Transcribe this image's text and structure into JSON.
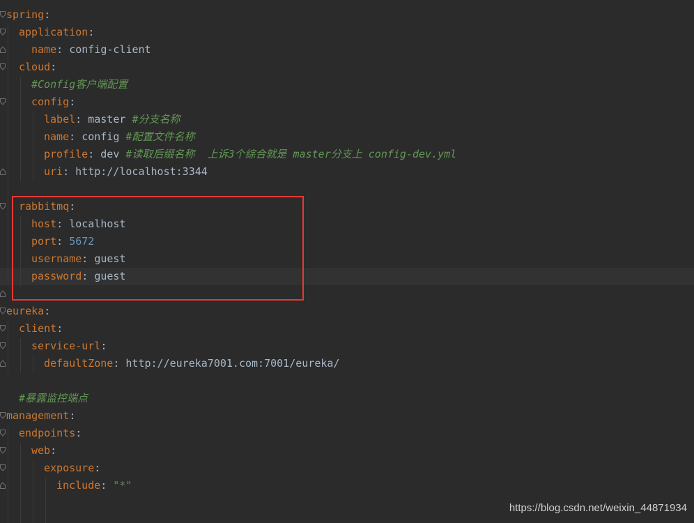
{
  "editor": {
    "file_type": "yaml",
    "theme_colors": {
      "background": "#2b2b2b",
      "key": "#cc7832",
      "value": "#a9b7c6",
      "number": "#6897bb",
      "string": "#6a8759",
      "comment": "#629755",
      "highlight_box": "#e53935"
    },
    "lines": {
      "l1": {
        "key": "spring",
        "colon": ":"
      },
      "l2": {
        "key": "application",
        "colon": ":"
      },
      "l3": {
        "key": "name",
        "colon": ": ",
        "value": "config-client"
      },
      "l4": {
        "key": "cloud",
        "colon": ":"
      },
      "l5": {
        "comment": "#Config客户端配置"
      },
      "l6": {
        "key": "config",
        "colon": ":"
      },
      "l7": {
        "key": "label",
        "colon": ": ",
        "value": "master ",
        "comment": "#分支名称"
      },
      "l8": {
        "key": "name",
        "colon": ": ",
        "value": "config ",
        "comment": "#配置文件名称"
      },
      "l9": {
        "key": "profile",
        "colon": ": ",
        "value": "dev ",
        "comment": "#读取后缀名称  上诉3个综合就是 master分支上 config-dev.yml"
      },
      "l10": {
        "key": "uri",
        "colon": ": ",
        "value": "http://localhost:3344"
      },
      "l12": {
        "key": "rabbitmq",
        "colon": ":"
      },
      "l13": {
        "key": "host",
        "colon": ": ",
        "value": "localhost"
      },
      "l14": {
        "key": "port",
        "colon": ": ",
        "value": "5672"
      },
      "l15": {
        "key": "username",
        "colon": ": ",
        "value": "guest"
      },
      "l16": {
        "key": "password",
        "colon": ": ",
        "value": "guest"
      },
      "l18": {
        "key": "eureka",
        "colon": ":"
      },
      "l19": {
        "key": "client",
        "colon": ":"
      },
      "l20": {
        "key": "service-url",
        "colon": ":"
      },
      "l21": {
        "key": "defaultZone",
        "colon": ": ",
        "value": "http://eureka7001.com:7001/eureka/"
      },
      "l23": {
        "comment": "#暴露监控端点"
      },
      "l24": {
        "key": "management",
        "colon": ":"
      },
      "l25": {
        "key": "endpoints",
        "colon": ":"
      },
      "l26": {
        "key": "web",
        "colon": ":"
      },
      "l27": {
        "key": "exposure",
        "colon": ":"
      },
      "l28": {
        "key": "include",
        "colon": ": ",
        "value": "\"*\""
      }
    }
  },
  "watermark": {
    "text": "https://blog.csdn.net/weixin_44871934"
  }
}
